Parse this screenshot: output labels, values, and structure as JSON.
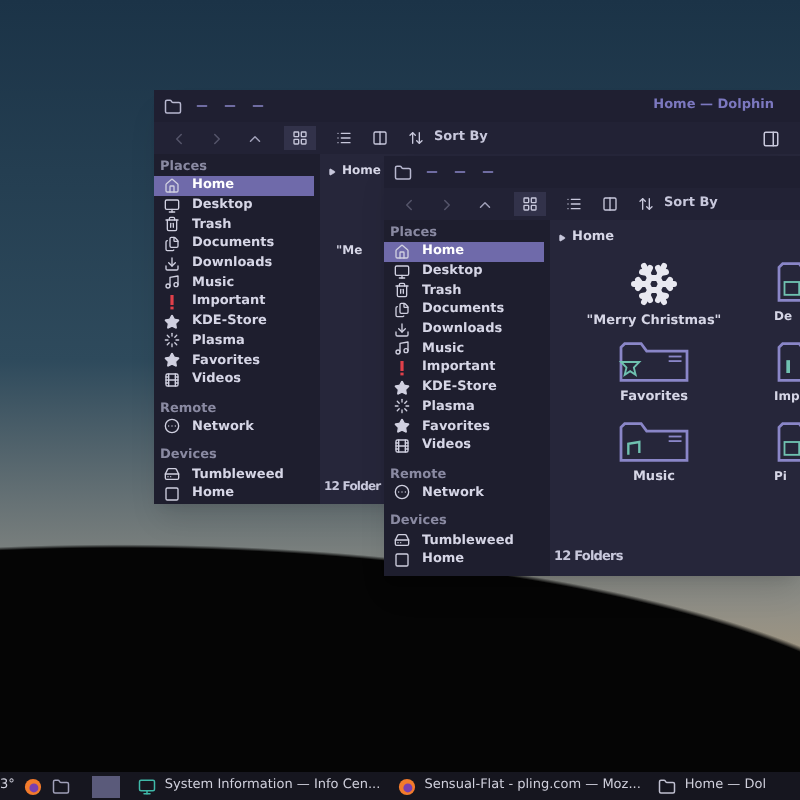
{
  "windows": [
    {
      "title": "Home — Dolphin",
      "sort_label": "Sort By",
      "breadcrumb": "Home",
      "places_panel_button": true,
      "sections": [
        {
          "header": "Places",
          "items": [
            {
              "label": "Home",
              "selected": true
            },
            {
              "label": "Desktop",
              "selected": false
            },
            {
              "label": "Trash",
              "selected": false
            },
            {
              "label": "Documents",
              "selected": false
            },
            {
              "label": "Downloads",
              "selected": false
            },
            {
              "label": "Music",
              "selected": false
            },
            {
              "label": "Important",
              "selected": false
            },
            {
              "label": "KDE-Store",
              "selected": false
            },
            {
              "label": "Plasma",
              "selected": false
            },
            {
              "label": "Favorites",
              "selected": false
            },
            {
              "label": "Videos",
              "selected": false
            }
          ]
        },
        {
          "header": "Remote",
          "items": [
            {
              "label": "Network",
              "selected": false
            }
          ]
        },
        {
          "header": "Devices",
          "items": [
            {
              "label": "Tumbleweed",
              "selected": false
            },
            {
              "label": "Home",
              "selected": false
            }
          ]
        }
      ],
      "files": [
        {
          "label": "\"Me",
          "kind": "text"
        }
      ],
      "status": "12 Folder"
    },
    {
      "sort_label": "Sort By",
      "breadcrumb": "Home",
      "places_panel_button": false,
      "sections": [
        {
          "header": "Places",
          "items": [
            {
              "label": "Home",
              "selected": true
            },
            {
              "label": "Desktop",
              "selected": false
            },
            {
              "label": "Trash",
              "selected": false
            },
            {
              "label": "Documents",
              "selected": false
            },
            {
              "label": "Downloads",
              "selected": false
            },
            {
              "label": "Music",
              "selected": false
            },
            {
              "label": "Important",
              "selected": false
            },
            {
              "label": "KDE-Store",
              "selected": false
            },
            {
              "label": "Plasma",
              "selected": false
            },
            {
              "label": "Favorites",
              "selected": false
            },
            {
              "label": "Videos",
              "selected": false
            }
          ]
        },
        {
          "header": "Remote",
          "items": [
            {
              "label": "Network",
              "selected": false
            }
          ]
        },
        {
          "header": "Devices",
          "items": [
            {
              "label": "Tumbleweed",
              "selected": false
            },
            {
              "label": "Home",
              "selected": false
            }
          ]
        }
      ],
      "files": [
        {
          "label": "\"Merry Christmas\"",
          "kind": "snowflake"
        },
        {
          "label": "De",
          "kind": "folder"
        },
        {
          "label": "Favorites",
          "kind": "folder"
        },
        {
          "label": "Imp",
          "kind": "folder"
        },
        {
          "label": "Music",
          "kind": "folder"
        },
        {
          "label": "Pi",
          "kind": "folder"
        }
      ],
      "status": "12 Folders"
    }
  ],
  "taskbar": {
    "weather": "3°",
    "tasks": [
      {
        "label": "System Information  — Info Cen...",
        "kind": "monitor"
      },
      {
        "label": "Sensual-Flat - pling.com — Moz...",
        "kind": "browser"
      },
      {
        "label": "Home — Dol",
        "kind": "folder"
      }
    ]
  }
}
